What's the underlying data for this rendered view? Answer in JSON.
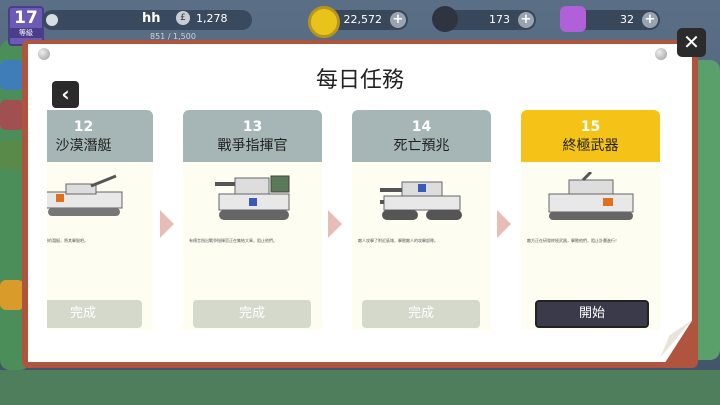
{
  "hud": {
    "level": "17",
    "level_sub": "等級",
    "player_name": "hh",
    "rank_icon": "£",
    "rank_value": "1,278",
    "xp_text": "851 / 1,500",
    "coins": "22,572",
    "bombs": "173",
    "gems": "32",
    "plus": "+"
  },
  "modal": {
    "title": "每日任務",
    "back_icon": "‹",
    "close_icon": "✕"
  },
  "missions": [
    {
      "num": "12",
      "name": "沙漠潛艇",
      "desc": "在沙漠深處發現的潛艇，將其擊毀吧。",
      "button": "完成"
    },
    {
      "num": "13",
      "name": "戰爭指揮官",
      "desc": "有傳言指出戰爭指揮官正在集結大軍，阻止他們。",
      "button": "完成"
    },
    {
      "num": "14",
      "name": "死亡預兆",
      "desc": "敵人攻擊了附近區域，擊敗敵人的攻擊部隊。",
      "button": "完成"
    },
    {
      "num": "15",
      "name": "終極武器",
      "desc": "敵方正在研發終極武器，擊敗他們，阻止計畫進行！",
      "button": "開始"
    }
  ],
  "colors": {
    "card_head_done": "#a6b6b6",
    "card_head_active": "#f5c318",
    "modal_border": "#b0543d"
  }
}
